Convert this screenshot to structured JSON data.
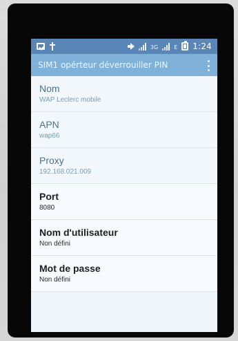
{
  "status_bar": {
    "left_icons": [
      "image-icon",
      "usb-icon"
    ],
    "right_icons": [
      "volume-icon",
      "signal-icon",
      "signal-icon",
      "battery-icon"
    ],
    "time": "1:24",
    "signal_labels": [
      "3G",
      "E"
    ]
  },
  "app_bar": {
    "title": "SIM1 opérteur déverrouiller PIN",
    "overflow_icon": "more-vert-icon"
  },
  "items": [
    {
      "title": "Nom",
      "value": "WAP Leclerc mobile"
    },
    {
      "title": "APN",
      "value": "wap66"
    },
    {
      "title": "Proxy",
      "value": "192.168.021.009"
    },
    {
      "title": "Port",
      "value": "8080"
    },
    {
      "title": "Nom d'utilisateur",
      "value": "Non défini"
    },
    {
      "title": "Mot de passe",
      "value": "Non défini"
    }
  ],
  "colors": {
    "status_bar_bg": "#5a85b7",
    "app_bar_bg": "#7fb1d9",
    "list_bg": "#eef6fb"
  }
}
